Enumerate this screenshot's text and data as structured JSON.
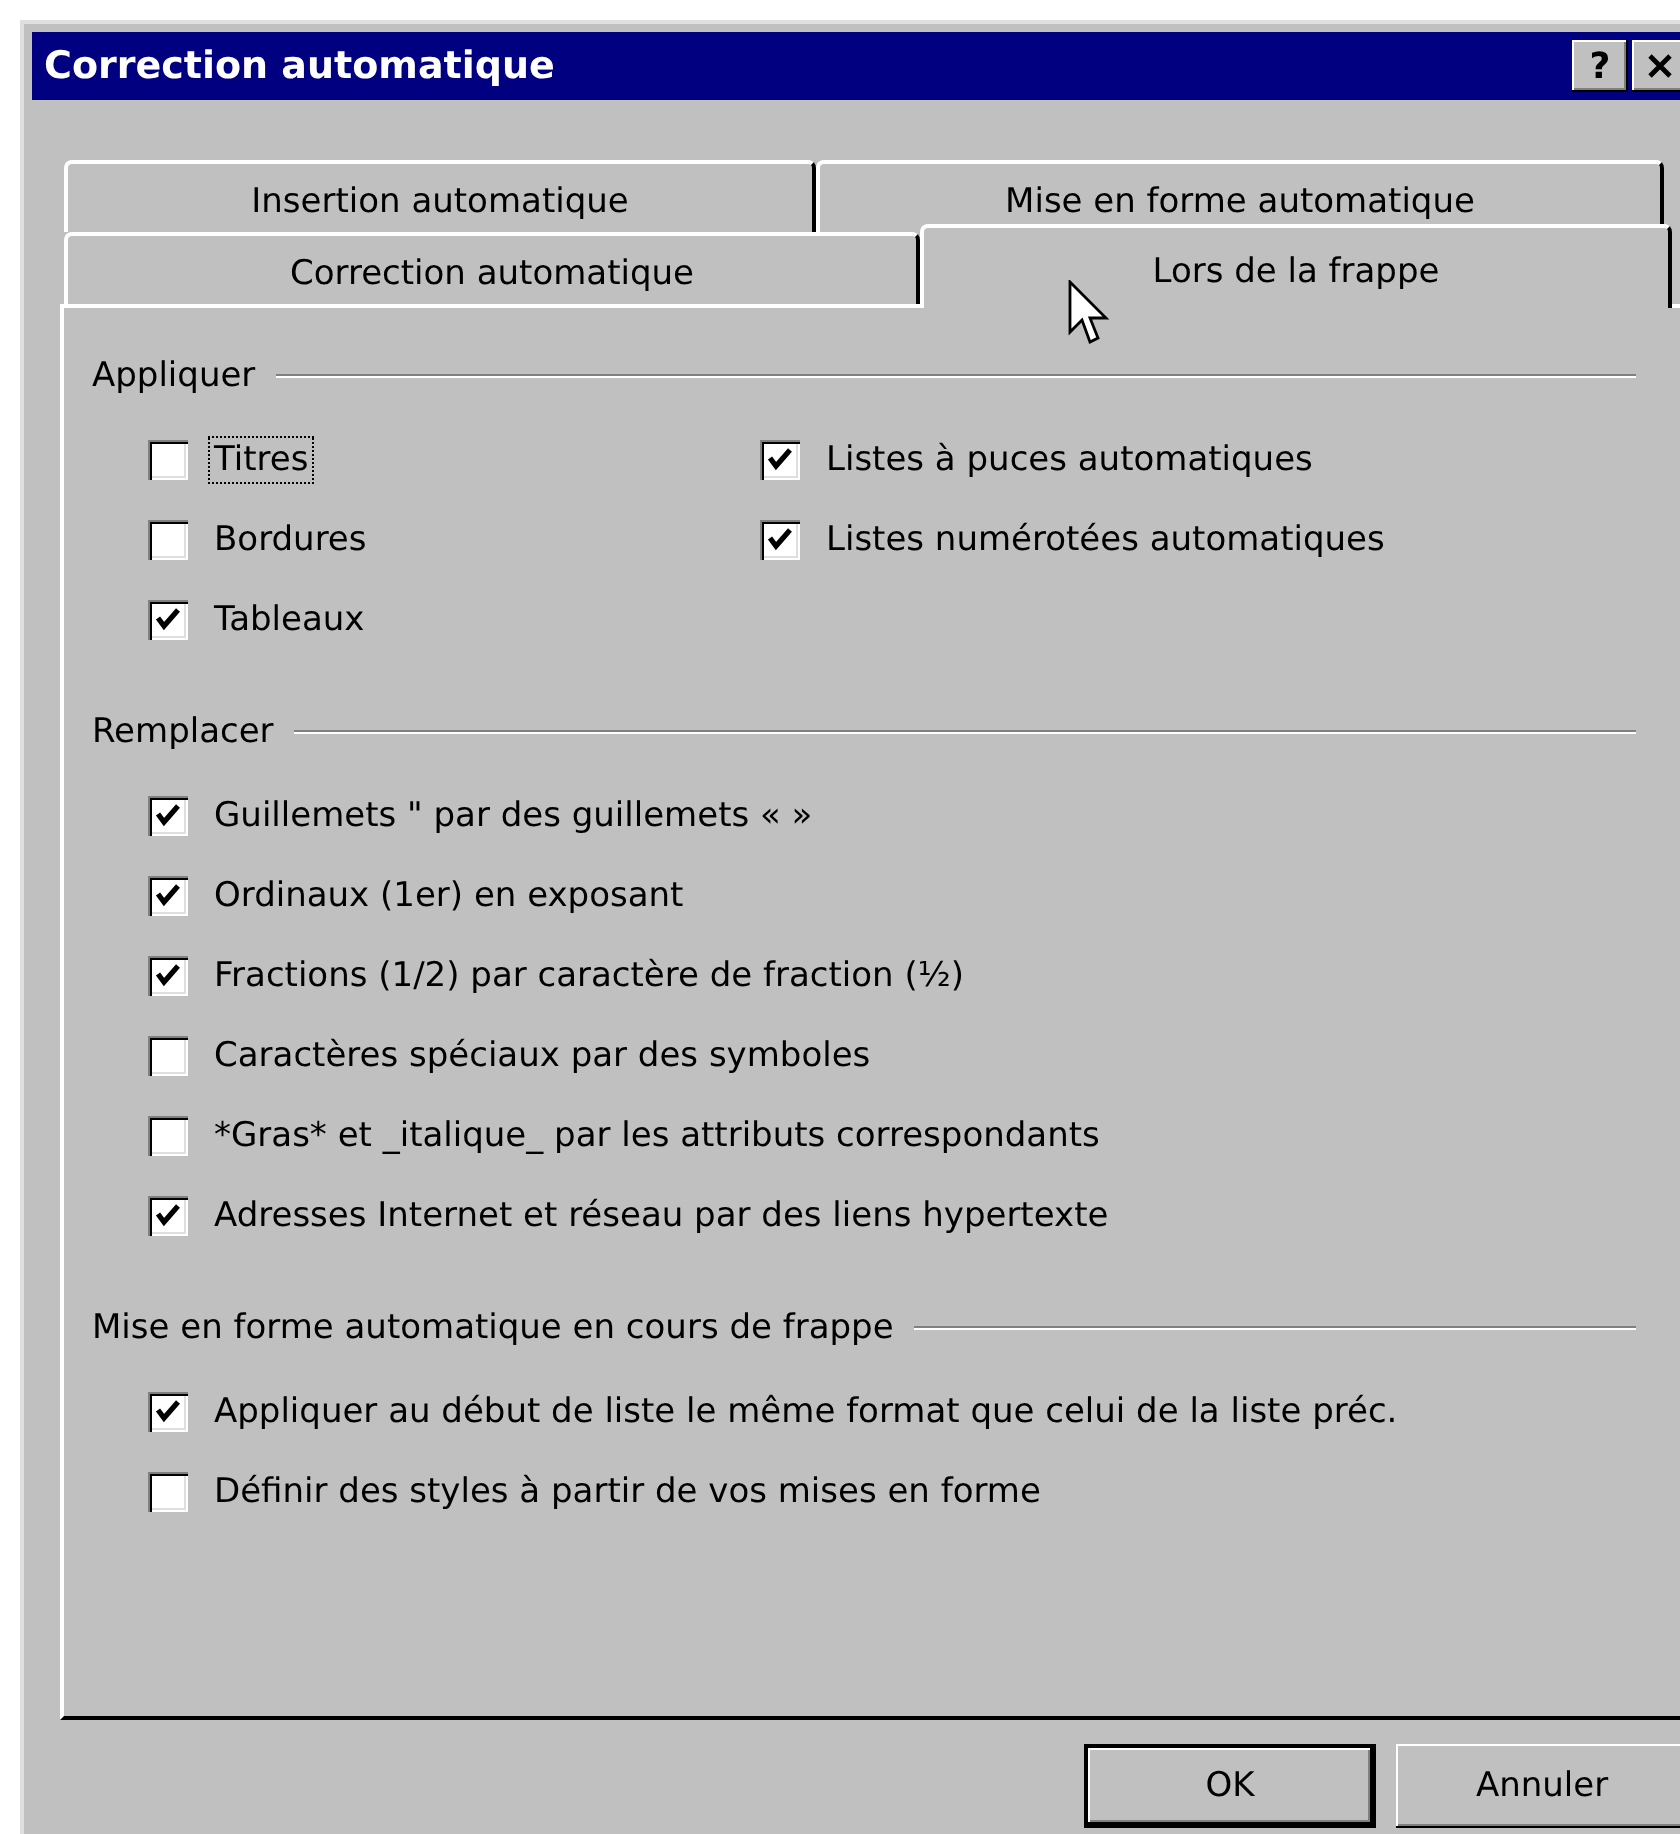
{
  "window": {
    "title": "Correction automatique",
    "help": "?"
  },
  "tab_rows": [
    [
      {
        "label": "Insertion automatique",
        "selected": false
      },
      {
        "label": "Mise en forme automatique",
        "selected": false
      }
    ],
    [
      {
        "label": "Correction automatique",
        "selected": false
      },
      {
        "label": "Lors de la frappe",
        "selected": true
      }
    ]
  ],
  "groups": [
    {
      "title": "Appliquer",
      "columns": [
        [
          {
            "label": "Titres",
            "checked": false,
            "focused": true
          },
          {
            "label": "Bordures",
            "checked": false,
            "focused": false
          },
          {
            "label": "Tableaux",
            "checked": true,
            "focused": false
          }
        ],
        [
          {
            "label": "Listes à puces automatiques",
            "checked": true,
            "focused": false
          },
          {
            "label": "Listes numérotées automatiques",
            "checked": true,
            "focused": false
          }
        ]
      ]
    },
    {
      "title": "Remplacer",
      "columns": [
        [
          {
            "label": "Guillemets \" par des guillemets « »",
            "checked": true,
            "focused": false
          },
          {
            "label": "Ordinaux (1er) en exposant",
            "checked": true,
            "focused": false
          },
          {
            "label": "Fractions (1/2) par caractère de fraction (½)",
            "checked": true,
            "focused": false
          },
          {
            "label": "Caractères spéciaux par des symboles",
            "checked": false,
            "focused": false
          },
          {
            "label": "*Gras* et _italique_ par les attributs correspondants",
            "checked": false,
            "focused": false
          },
          {
            "label": "Adresses Internet et réseau par des liens hypertexte",
            "checked": true,
            "focused": false
          }
        ]
      ]
    },
    {
      "title": "Mise en forme automatique en cours de frappe",
      "columns": [
        [
          {
            "label": "Appliquer au début de liste le même format que celui de la liste préc.",
            "checked": true,
            "focused": false
          },
          {
            "label": "Définir des styles à partir de vos mises en forme",
            "checked": false,
            "focused": false
          }
        ]
      ]
    }
  ],
  "buttons": [
    "OK",
    "Annuler"
  ]
}
